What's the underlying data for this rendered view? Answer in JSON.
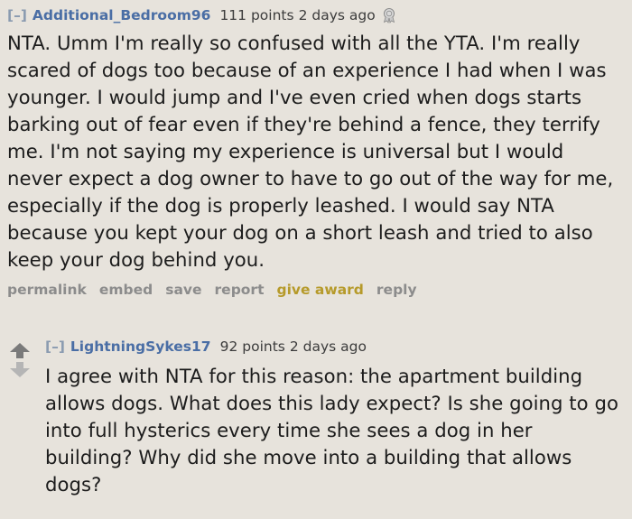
{
  "comment1": {
    "collapse": "[–]",
    "author": "Additional_Bedroom96",
    "score": "111 points",
    "time": "2 days ago",
    "award_icon": "silver-award-icon",
    "body": "NTA. Umm I'm really so confused with all the YTA. I'm really scared of dogs too because of an experience I had when I was younger. I would jump and I've even cried when dogs starts barking out of fear even if they're behind a fence, they terrify me. I'm not saying my experience is universal but I would never expect a dog owner to have to go out of the way for me, especially if the dog is properly leashed. I would say NTA because you kept your dog on a short leash and tried to also keep your dog behind you.",
    "buttons": {
      "permalink": "permalink",
      "embed": "embed",
      "save": "save",
      "report": "report",
      "give_award": "give award",
      "reply": "reply"
    }
  },
  "comment2": {
    "collapse": "[–]",
    "author": "LightningSykes17",
    "score": "92 points",
    "time": "2 days ago",
    "body": "I agree with NTA for this reason: the apartment building allows dogs. What does this lady expect? Is she going to go into full hysterics every time she sees a dog in her building? Why did she move into a building that allows dogs?"
  },
  "colors": {
    "background": "#e7e3dc",
    "author": "#4a6ea5",
    "gold_button": "#b69a2a",
    "muted_button": "#8c8c8c"
  }
}
